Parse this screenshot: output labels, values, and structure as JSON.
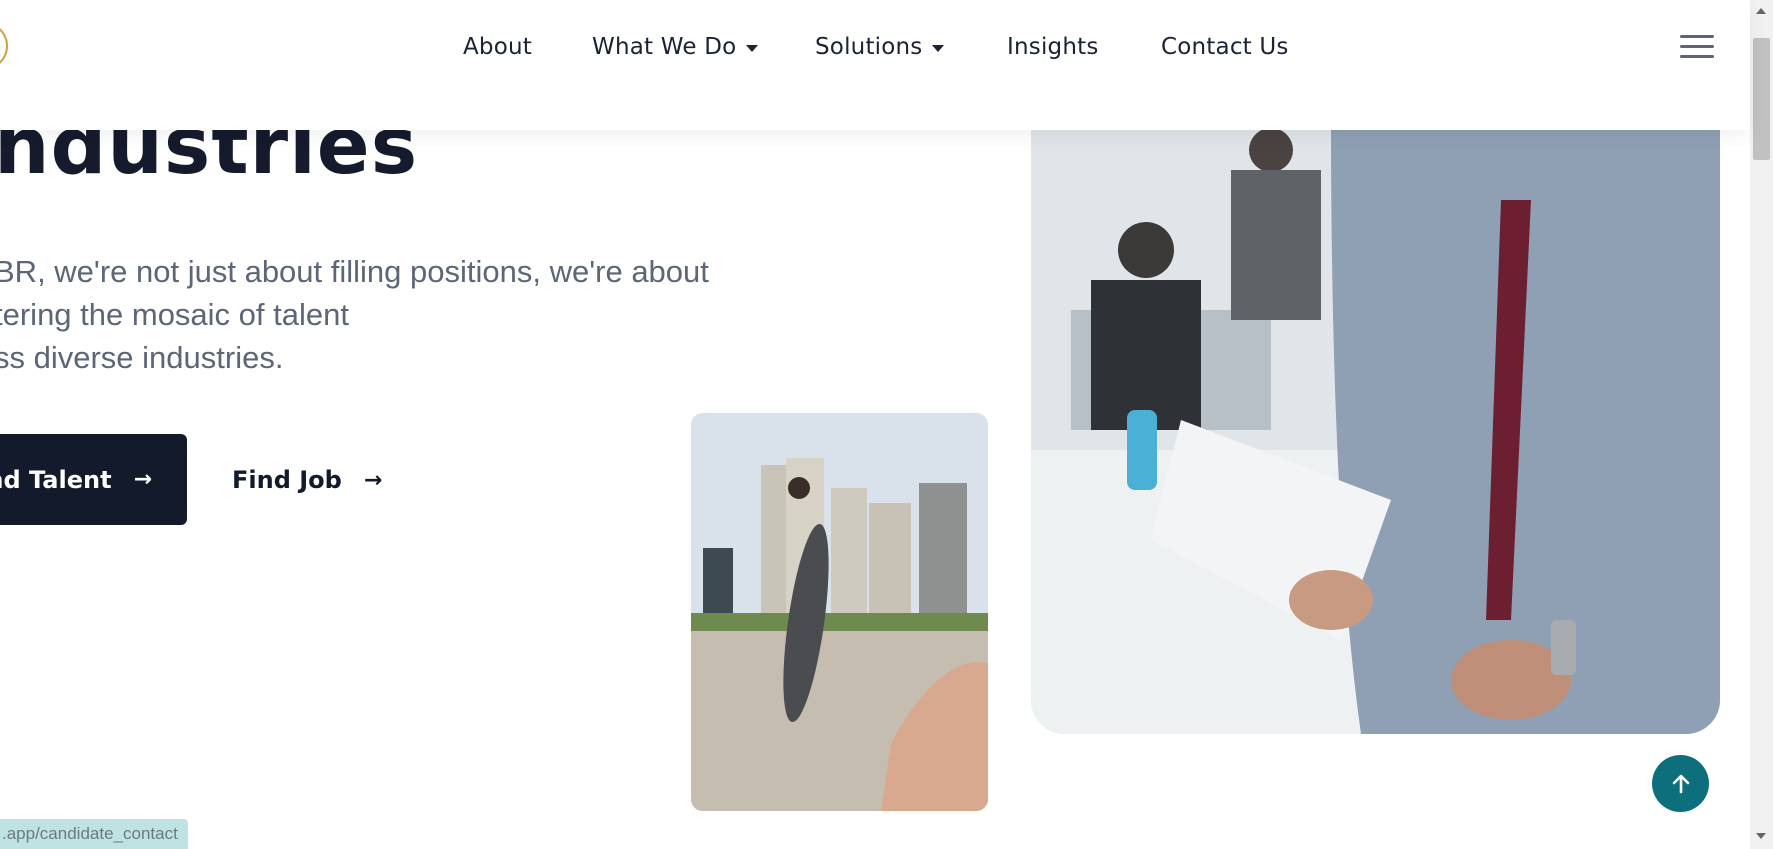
{
  "nav": {
    "items": [
      {
        "label": "About",
        "dropdown": false
      },
      {
        "label": "What We Do",
        "dropdown": true
      },
      {
        "label": "Solutions",
        "dropdown": true
      },
      {
        "label": "Insights",
        "dropdown": false
      },
      {
        "label": "Contact Us",
        "dropdown": false
      }
    ],
    "menu_icon": "hamburger-icon"
  },
  "hero": {
    "title": "ndustries",
    "description": [
      "BR, we're not just about filling positions, we're about",
      "tering the mosaic of talent",
      "ss diverse industries."
    ],
    "primary_button": "nd Talent",
    "secondary_button": "Find Job",
    "arrow_icon": "arrow-right-icon"
  },
  "images": {
    "small": "businesswoman-walking-onto-hand",
    "large": "businessman-holding-document"
  },
  "scroll_top_icon": "arrow-up-icon",
  "status_url": ".app/candidate_contact",
  "colors": {
    "dark_navy": "#131a2b",
    "teal": "#0e6f7c",
    "text_gray": "#5c6677"
  }
}
